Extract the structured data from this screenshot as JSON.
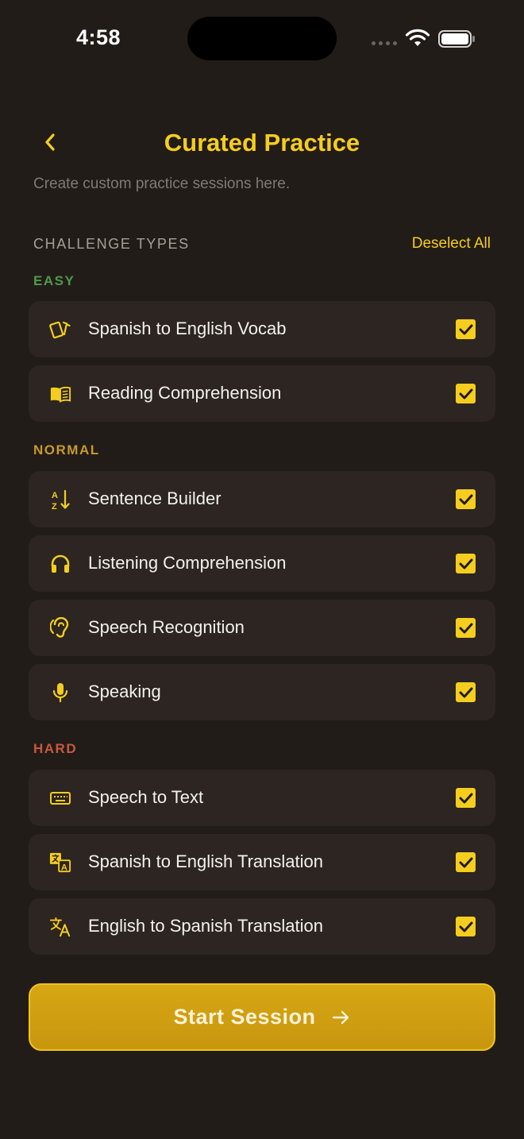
{
  "status": {
    "time": "4:58"
  },
  "header": {
    "title": "Curated Practice",
    "subtitle": "Create custom practice sessions here."
  },
  "section": {
    "title": "CHALLENGE TYPES",
    "deselect_label": "Deselect All"
  },
  "groups": [
    {
      "label": "EASY",
      "color": "#4f9a4a",
      "items": [
        {
          "label": "Spanish to English Vocab",
          "icon": "cards-icon",
          "checked": true
        },
        {
          "label": "Reading Comprehension",
          "icon": "book-icon",
          "checked": true
        }
      ]
    },
    {
      "label": "NORMAL",
      "color": "#c79a2c",
      "items": [
        {
          "label": "Sentence Builder",
          "icon": "sort-az-icon",
          "checked": true
        },
        {
          "label": "Listening Comprehension",
          "icon": "headphones-icon",
          "checked": true
        },
        {
          "label": "Speech Recognition",
          "icon": "ear-icon",
          "checked": true
        },
        {
          "label": "Speaking",
          "icon": "microphone-icon",
          "checked": true
        }
      ]
    },
    {
      "label": "HARD",
      "color": "#c65a3c",
      "items": [
        {
          "label": "Speech to Text",
          "icon": "keyboard-icon",
          "checked": true
        },
        {
          "label": "Spanish to English Translation",
          "icon": "translate-icon",
          "checked": true
        },
        {
          "label": "English to Spanish Translation",
          "icon": "translate-alt-icon",
          "checked": true
        }
      ]
    }
  ],
  "footer": {
    "start_label": "Start Session"
  },
  "colors": {
    "accent": "#f5cd1e",
    "background": "#221c18",
    "card": "#2c2521",
    "button": "#c8960e"
  }
}
